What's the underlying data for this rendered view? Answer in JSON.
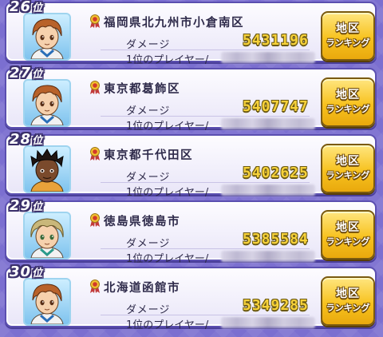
{
  "rank_suffix": "位",
  "damage_label": "ダメージ",
  "top_player_label": "1位のプレイヤー/",
  "button": {
    "line1": "地区",
    "line2": "ランキング"
  },
  "entries": [
    {
      "rank": "26",
      "area": "福岡県北九州市小倉南区",
      "damage": "5431196",
      "avatar": "brown-haired-boy"
    },
    {
      "rank": "27",
      "area": "東京都葛飾区",
      "damage": "5407747",
      "avatar": "brown-haired-boy"
    },
    {
      "rank": "28",
      "area": "東京都千代田区",
      "damage": "5402625",
      "avatar": "dark-skinned-boy"
    },
    {
      "rank": "29",
      "area": "徳島県徳島市",
      "damage": "5385584",
      "avatar": "blond-haired-boy"
    },
    {
      "rank": "30",
      "area": "北海道函館市",
      "damage": "5349285",
      "avatar": "brown-haired-boy"
    }
  ],
  "colors": {
    "background": "#7b6fd0",
    "card_border": "#5b4fb0",
    "damage_value": "#f7d23a",
    "button": "#f7c21f"
  }
}
